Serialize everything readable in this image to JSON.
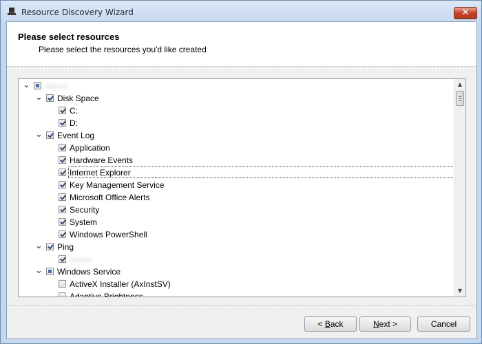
{
  "window": {
    "title": "Resource Discovery Wizard",
    "app_icon": "wizard-hat-icon",
    "close_glyph": "✕"
  },
  "header": {
    "title": "Please select resources",
    "subtitle": "Please select the resources you'd like created"
  },
  "tree": {
    "rows": [
      {
        "level": 0,
        "expanded": true,
        "state": "partial",
        "label": "server",
        "blurred": true
      },
      {
        "level": 1,
        "expanded": true,
        "state": "checked",
        "label": "Disk Space"
      },
      {
        "level": 2,
        "state": "checked",
        "label": "C:"
      },
      {
        "level": 2,
        "state": "checked",
        "label": "D:"
      },
      {
        "level": 1,
        "expanded": true,
        "state": "checked",
        "label": "Event Log"
      },
      {
        "level": 2,
        "state": "checked",
        "label": "Application"
      },
      {
        "level": 2,
        "state": "checked",
        "label": "Hardware Events"
      },
      {
        "level": 2,
        "state": "checked",
        "label": "Internet Explorer",
        "focused": true
      },
      {
        "level": 2,
        "state": "checked",
        "label": "Key Management Service"
      },
      {
        "level": 2,
        "state": "checked",
        "label": "Microsoft Office Alerts"
      },
      {
        "level": 2,
        "state": "checked",
        "label": "Security"
      },
      {
        "level": 2,
        "state": "checked",
        "label": "System"
      },
      {
        "level": 2,
        "state": "checked",
        "label": "Windows PowerShell"
      },
      {
        "level": 1,
        "expanded": true,
        "state": "checked",
        "label": "Ping"
      },
      {
        "level": 2,
        "state": "checked",
        "label": "server",
        "blurred": true
      },
      {
        "level": 1,
        "expanded": true,
        "state": "partial",
        "label": "Windows Service"
      },
      {
        "level": 2,
        "state": "unchecked",
        "label": "ActiveX Installer (AxInstSV)"
      },
      {
        "level": 2,
        "state": "unchecked",
        "label": "Adaptive Brightness"
      }
    ]
  },
  "buttons": {
    "back": {
      "prefix": "< ",
      "mnemonic": "B",
      "rest": "ack"
    },
    "next": {
      "mnemonic": "N",
      "rest": "ext >"
    },
    "cancel": {
      "label": "Cancel"
    }
  },
  "icons": {
    "expander": "chevron-down-icon",
    "scroll_up": "scroll-up-arrow-icon",
    "scroll_down": "scroll-down-arrow-icon"
  }
}
